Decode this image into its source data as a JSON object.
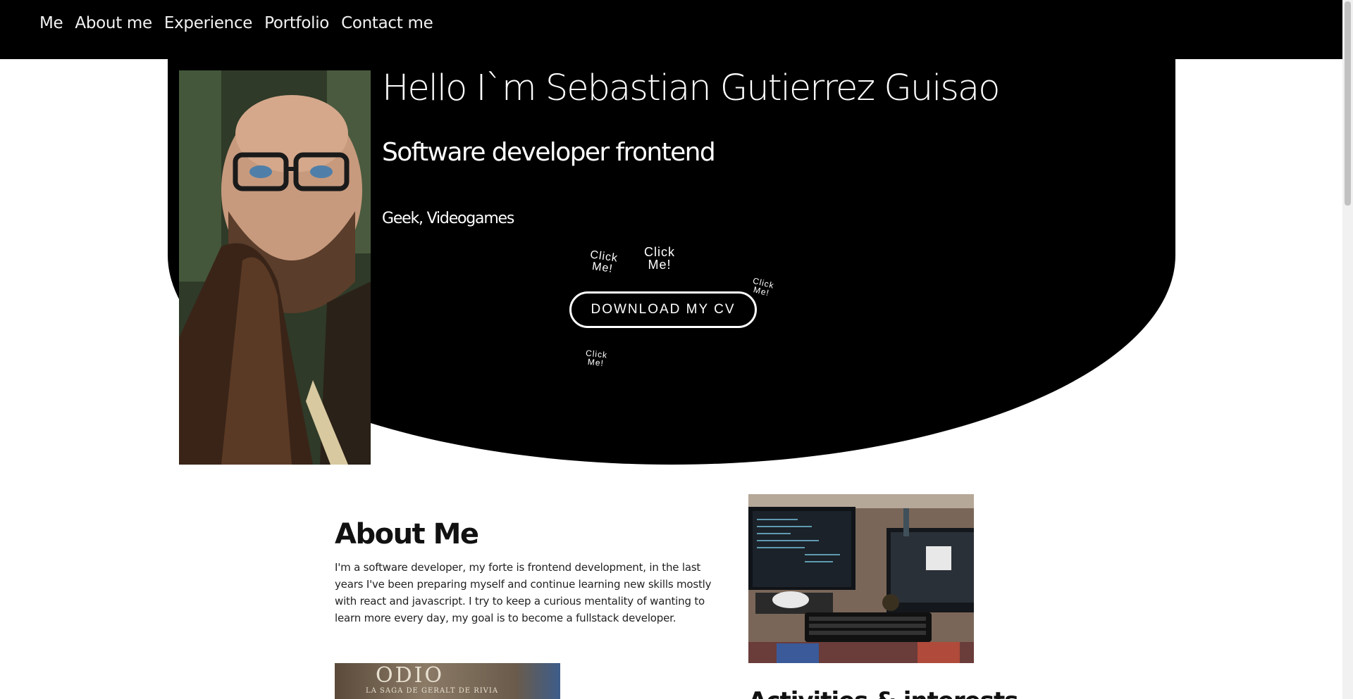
{
  "nav": {
    "links": [
      "Me",
      "About me",
      "Experience",
      "Portfolio",
      "Contact me"
    ]
  },
  "hero": {
    "title": "Hello I`m Sebastian Gutierrez Guisao",
    "subtitle": "Software developer frontend",
    "tags": "Geek, Videogames",
    "click_label": "Click Me!",
    "download_label": "DOWNLOAD MY CV"
  },
  "about": {
    "heading": "About Me",
    "text": "I'm a software developer, my forte is frontend development, in the last years I've been preparing myself and continue learning new skills mostly with react and javascript. I try to keep a curious mentality of wanting to learn more every day, my goal is to become a fullstack developer."
  },
  "book": {
    "title": "ODIO",
    "subtitle": "LA SAGA DE GERALT DE RIVIA"
  },
  "activities": {
    "heading": "Activities & interests"
  },
  "colors": {
    "hero_bg": "#000000",
    "page_bg": "#ffffff",
    "text_light": "#ffffff"
  }
}
